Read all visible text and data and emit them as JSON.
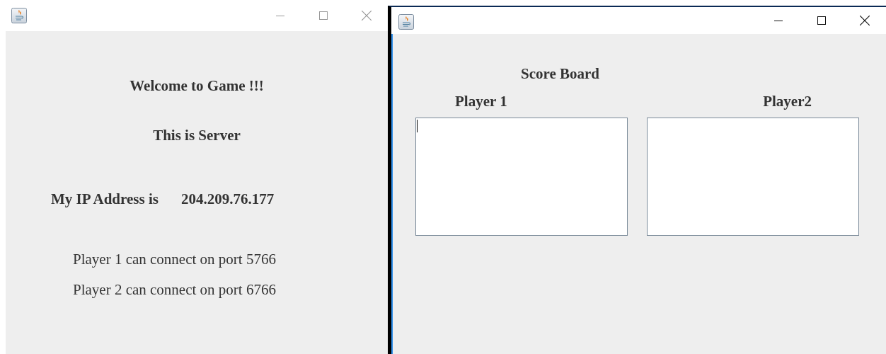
{
  "server_window": {
    "active": false,
    "heading": "Welcome to Game !!!",
    "subheading": "This is Server",
    "ip_label": "My IP Address is",
    "ip_address": "204.209.76.177",
    "ports": [
      "Player 1 can connect on port 5766",
      "Player 2 can connect on port 6766"
    ]
  },
  "scoreboard_window": {
    "active": true,
    "title": "Score Board",
    "players": [
      {
        "label": "Player 1",
        "focused": true
      },
      {
        "label": "Player2",
        "focused": false
      }
    ]
  }
}
